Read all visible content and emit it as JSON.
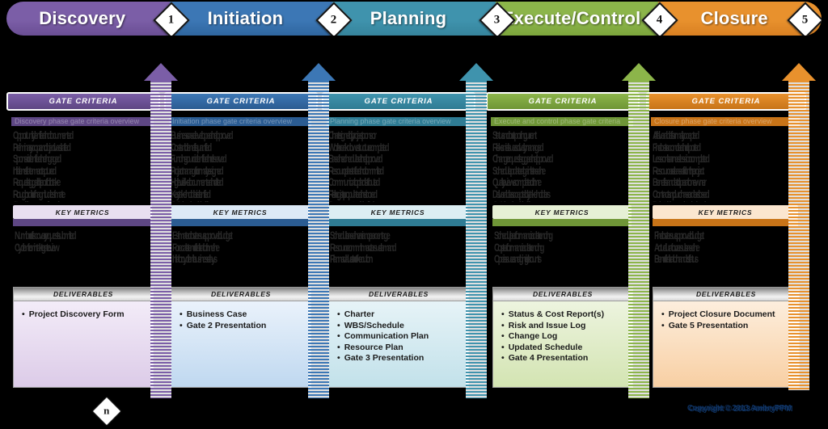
{
  "banner": {
    "phases": [
      {
        "label": "Discovery",
        "color": "#7B5EA7",
        "color_dark": "#6A4E94",
        "gate": "1"
      },
      {
        "label": "Initiation",
        "color": "#3C77B5",
        "color_dark": "#2F669F",
        "gate": "2"
      },
      {
        "label": "Planning",
        "color": "#3F93AD",
        "color_dark": "#36849C",
        "gate": "3"
      },
      {
        "label": "Execute/Control",
        "color": "#8CB54A",
        "color_dark": "#7CA53C",
        "gate": "4"
      },
      {
        "label": "Closure",
        "color": "#E8912D",
        "color_dark": "#D98022",
        "gate": "5"
      }
    ]
  },
  "section_titles": {
    "gate_criteria": "GATE CRITERIA",
    "key_metrics": "KEY METRICS",
    "deliverables": "DELIVERABLES"
  },
  "columns": [
    {
      "name": "discovery",
      "accent": "#7B5EA7",
      "accent_dark": "#5E4784",
      "km_header_bg": "#E8DFF0",
      "dl_body_bg_top": "#F3ECF8",
      "dl_body_bg_bottom": "#DCCBE8",
      "criteria_subtitle": "Discovery phase gate criteria overview",
      "criteria_lines": [
        "Opportunity identified and documented",
        "Preliminary scope and objectives drafted",
        "Sponsor identified and engaged",
        "Initial benefit statement captured",
        "Request logged in the portfolio intake",
        "Rough order of magnitude estimate",
        "Strategic alignment confirmed"
      ],
      "metrics_lines": [
        "Number of discovery requests submitted",
        "Cycle time from intake to gate review"
      ],
      "deliverables": [
        "Project Discovery Form"
      ]
    },
    {
      "name": "initiation",
      "accent": "#3C77B5",
      "accent_dark": "#2B5C92",
      "km_header_bg": "#DCE9F6",
      "dl_body_bg_top": "#EAF2FB",
      "dl_body_bg_bottom": "#BFD8F0",
      "criteria_subtitle": "Initiation phase gate criteria overview",
      "criteria_lines": [
        "Business case developed and approved",
        "Costs and benefits quantified",
        "Funding source identified and reserved",
        "Project manager formally assigned",
        "High level risks documented and rated",
        "Key stakeholders identified",
        "Gate 2 review scheduled with sponsor"
      ],
      "metrics_lines": [
        "Estimated cost versus approved budget",
        "Forecast benefit realization timeline",
        "Initiation cycle time in business days"
      ],
      "deliverables": [
        "Business Case",
        "Gate 2 Presentation"
      ]
    },
    {
      "name": "planning",
      "accent": "#3F93AD",
      "accent_dark": "#2F7C94",
      "km_header_bg": "#DCEEF3",
      "dl_body_bg_top": "#E6F3F7",
      "dl_body_bg_bottom": "#C2E1EA",
      "criteria_subtitle": "Planning phase gate criteria overview",
      "criteria_lines": [
        "Charter signed by project sponsor",
        "Work breakdown structure completed",
        "Baseline schedule built and approved",
        "Resource plan staffed and committed",
        "Communication plan distributed",
        "Risk register populated and scored",
        "Procurement needs identified"
      ],
      "metrics_lines": [
        "Schedule baseline variance percentage",
        "Resource commitment versus demand",
        "Planned value at start of execution"
      ],
      "deliverables": [
        "Charter",
        "WBS/Schedule",
        "Communication Plan",
        "Resource Plan",
        "Gate 3 Presentation"
      ]
    },
    {
      "name": "execute-control",
      "accent": "#8CB54A",
      "accent_dark": "#6F9637",
      "km_header_bg": "#E6F0D5",
      "dl_body_bg_top": "#EDF4DF",
      "dl_body_bg_bottom": "#D3E4B2",
      "criteria_subtitle": "Execute and control phase gate criteria",
      "criteria_lines": [
        "Status and cost reporting current",
        "Risks and issues actively managed",
        "Change requests logged and approved",
        "Schedule updated against baseline",
        "Quality reviews completed on time",
        "Deliverables accepted by stakeholders",
        "Gate 4 review scheduled with sponsor"
      ],
      "metrics_lines": [
        "Schedule performance index trending",
        "Cost performance index trending",
        "Open issues and aging risk counts"
      ],
      "deliverables": [
        "Status & Cost Report(s)",
        "Risk and Issue Log",
        "Change Log",
        "Updated Schedule",
        "Gate 4 Presentation"
      ]
    },
    {
      "name": "closure",
      "accent": "#E8912D",
      "accent_dark": "#C87418",
      "km_header_bg": "#FBE6CF",
      "dl_body_bg_top": "#FDEEDD",
      "dl_body_bg_bottom": "#F8CFA3",
      "criteria_subtitle": "Closure phase gate criteria overview",
      "criteria_lines": [
        "All deliverables formally accepted",
        "Final costs reconciled and reported",
        "Lessons learned session completed",
        "Resources released from the project",
        "Benefits handed to operations owner",
        "Contracts and purchase orders closed",
        "Project archive completed and stored"
      ],
      "metrics_lines": [
        "Final cost versus approved budget",
        "Actual duration versus baseline",
        "Benefit realization handoff status"
      ],
      "deliverables": [
        "Project Closure Document",
        "Gate 5 Presentation"
      ]
    }
  ],
  "bottom_marker": {
    "label": "n"
  },
  "copyright": {
    "text": "Copyright © 2013 AmbryPPM"
  }
}
